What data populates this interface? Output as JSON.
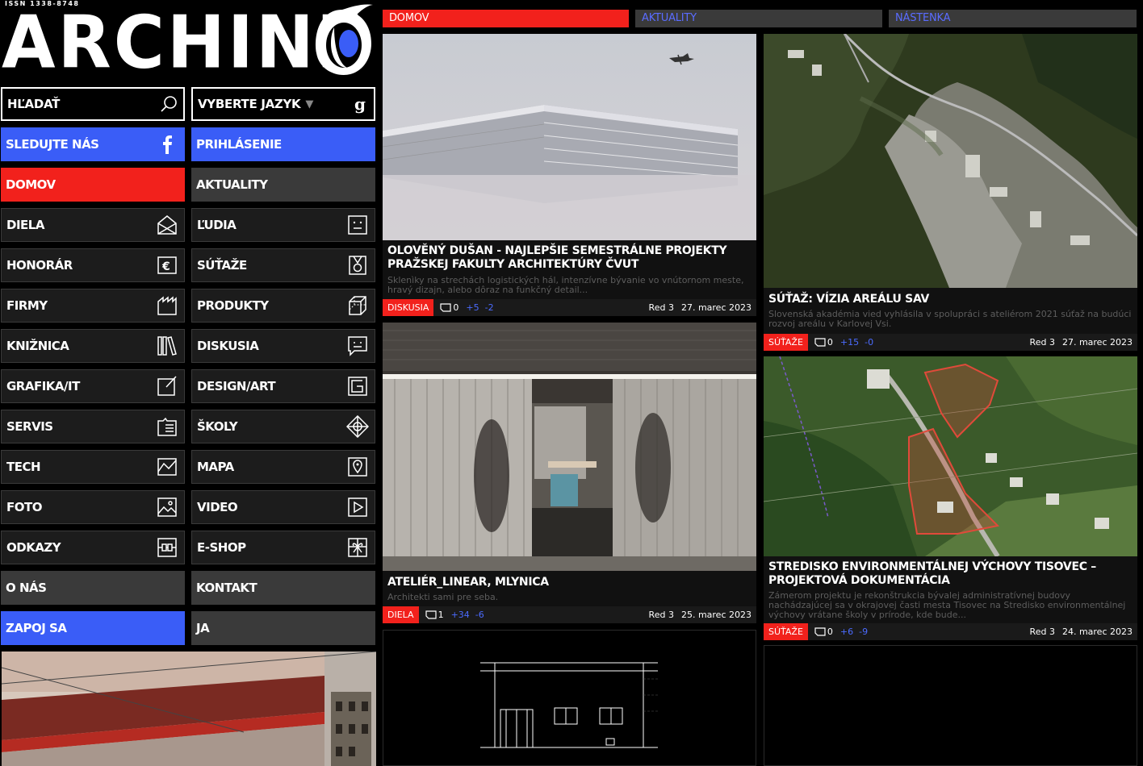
{
  "header": {
    "issn": "ISSN 1338-8748",
    "logo_text": "ARCHINF"
  },
  "search": {
    "label": "HĽADAŤ",
    "icon": "search-icon"
  },
  "language": {
    "label": "VYBERTE JAZYK",
    "icon": "google-icon"
  },
  "social": {
    "follow_label": "SLEDUJTE NÁS",
    "icon": "facebook-icon",
    "login_label": "PRIHLÁSENIE"
  },
  "menu": [
    [
      "DOMOV",
      "AKTUALITY"
    ],
    [
      "DIELA",
      "ĽUDIA"
    ],
    [
      "HONORÁR",
      "SÚŤAŽE"
    ],
    [
      "FIRMY",
      "PRODUKTY"
    ],
    [
      "KNIŽNICA",
      "DISKUSIA"
    ],
    [
      "GRAFIKA/IT",
      "DESIGN/ART"
    ],
    [
      "SERVIS",
      "ŠKOLY"
    ],
    [
      "TECH",
      "MAPA"
    ],
    [
      "FOTO",
      "VIDEO"
    ],
    [
      "ODKAZY",
      "E-SHOP"
    ],
    [
      "O NÁS",
      "KONTAKT"
    ],
    [
      "ZAPOJ SA",
      "JA"
    ]
  ],
  "tabs": [
    "DOMOV",
    "AKTUALITY",
    "NÁSTENKA"
  ],
  "articles": [
    {
      "title": "OLOVĚNÝ DUŠAN - NAJLEPŠIE SEMESTRÁLNE PROJEKTY PRAŽSKEJ FAKULTY ARCHITEKTÚRY ČVUT",
      "desc": "Sklenìky na strechách logistických hál, intenzívne bývanie vo vnútornom meste, hravý dizajn, alebo dôraz na funkčný detail...",
      "badge": "DISKUSIA",
      "comments": "0",
      "plus": "+5",
      "minus": "-2",
      "author": "Red 3",
      "date": "27. marec 2023"
    },
    {
      "title": "SÚŤAŽ: VÍZIA AREÁLU SAV",
      "desc": "Slovenská akadémia vied vyhlásila v spolupráci s ateliérom 2021 súťaž na budúci rozvoj areálu v Karlovej Vsi.",
      "badge": "SÚŤAŽE",
      "comments": "0",
      "plus": "+15",
      "minus": "-0",
      "author": "Red 3",
      "date": "27. marec 2023"
    },
    {
      "title": "ATELIÉR_LINEAR, MLYNICA",
      "desc": "Architekti sami pre seba.",
      "badge": "DIELA",
      "comments": "1",
      "plus": "+34",
      "minus": "-6",
      "author": "Red 3",
      "date": "25. marec 2023"
    },
    {
      "title": "STREDISKO ENVIRONMENTÁLNEJ VÝCHOVY TISOVEC – PROJEKTOVÁ DOKUMENTÁCIA",
      "desc": "Zámerom projektu je rekonštrukcia bývalej administratívnej budovy nachádzajúcej sa v okrajovej časti mesta Tisovec na Stredisko environmentálnej výchovy vrátane školy v prírode, kde bude...",
      "badge": "SÚŤAŽE",
      "comments": "0",
      "plus": "+6",
      "minus": "-9",
      "author": "Red 3",
      "date": "24. marec 2023"
    }
  ],
  "colors": {
    "red": "#f2211c",
    "blue": "#3a5df7",
    "gray": "#3a3a3a",
    "link_blue": "#4b6bff"
  }
}
